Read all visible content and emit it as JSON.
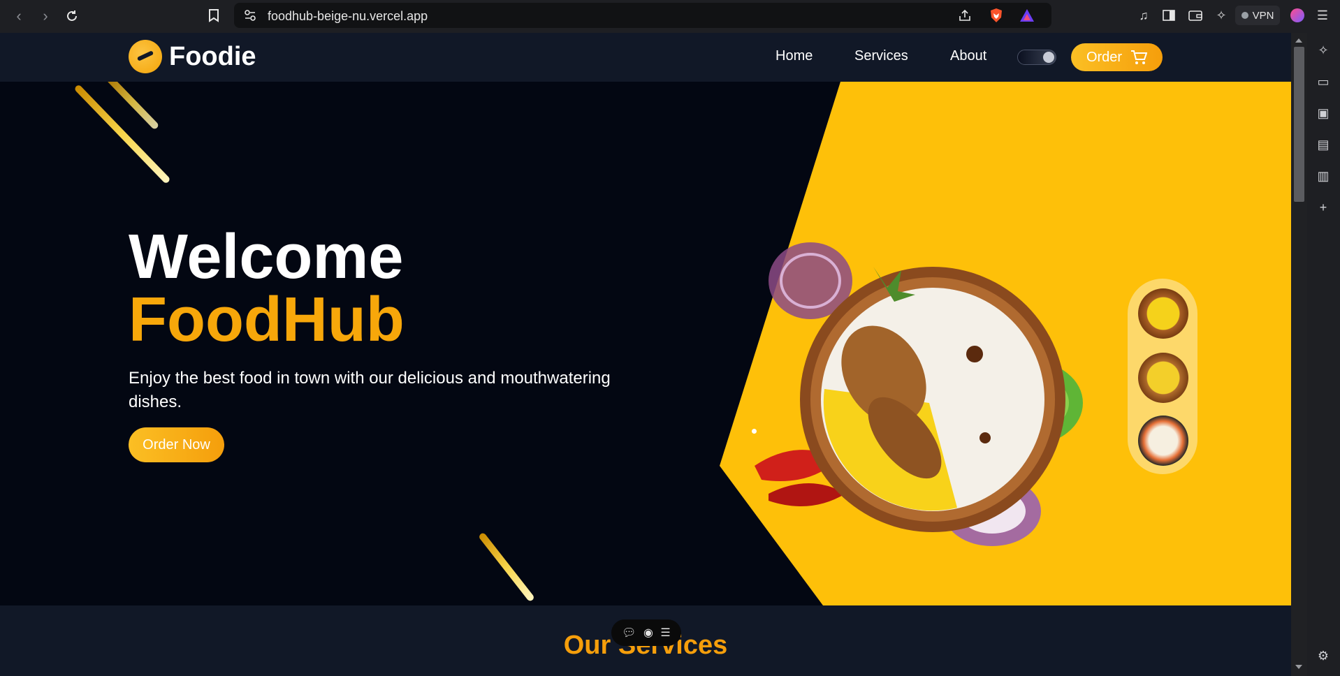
{
  "browser": {
    "url": "foodhub-beige-nu.vercel.app",
    "vpn_label": "VPN"
  },
  "site": {
    "brand": "Foodie",
    "nav": [
      {
        "label": "Home"
      },
      {
        "label": "Services"
      },
      {
        "label": "About"
      }
    ],
    "order_label": "Order"
  },
  "hero": {
    "title_line1": "Welcome",
    "title_line2": "FoodHub",
    "tagline": "Enjoy the best food in town with our delicious and mouthwatering dishes.",
    "cta_label": "Order Now"
  },
  "services": {
    "title": "Our Services"
  },
  "colors": {
    "accent": "#f59e0b",
    "hero_yellow": "#fec009",
    "navy": "#111827",
    "dark": "#030712"
  }
}
